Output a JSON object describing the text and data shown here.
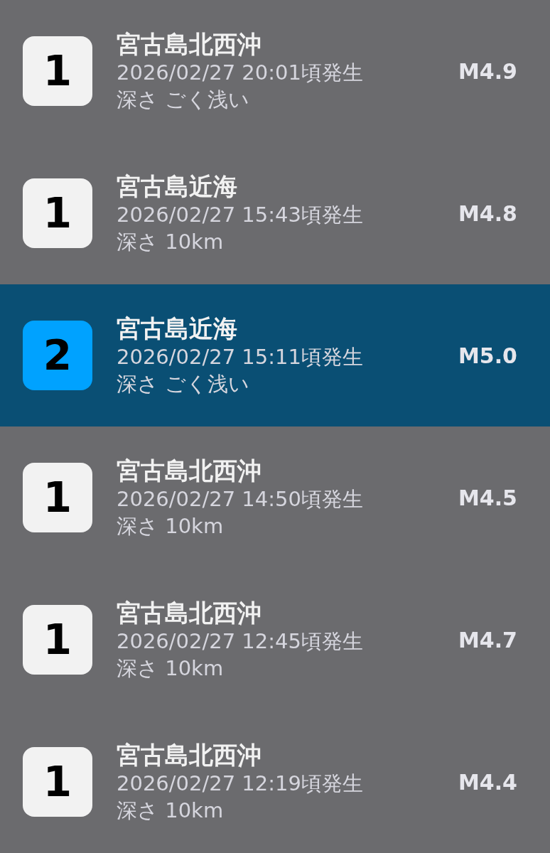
{
  "quakes": [
    {
      "intensity": "1",
      "color": "#f2f2f2",
      "place": "宮古島北西沖",
      "time": "2026/02/27 20:01頃発生",
      "depth": "深さ ごく浅い",
      "magnitude": "M4.9",
      "selected": false
    },
    {
      "intensity": "1",
      "color": "#f2f2f2",
      "place": "宮古島近海",
      "time": "2026/02/27 15:43頃発生",
      "depth": "深さ 10km",
      "magnitude": "M4.8",
      "selected": false
    },
    {
      "intensity": "2",
      "color": "#00a2ff",
      "place": "宮古島近海",
      "time": "2026/02/27 15:11頃発生",
      "depth": "深さ ごく浅い",
      "magnitude": "M5.0",
      "selected": true
    },
    {
      "intensity": "1",
      "color": "#f2f2f2",
      "place": "宮古島北西沖",
      "time": "2026/02/27 14:50頃発生",
      "depth": "深さ 10km",
      "magnitude": "M4.5",
      "selected": false
    },
    {
      "intensity": "1",
      "color": "#f2f2f2",
      "place": "宮古島北西沖",
      "time": "2026/02/27 12:45頃発生",
      "depth": "深さ 10km",
      "magnitude": "M4.7",
      "selected": false
    },
    {
      "intensity": "1",
      "color": "#f2f2f2",
      "place": "宮古島北西沖",
      "time": "2026/02/27 12:19頃発生",
      "depth": "深さ 10km",
      "magnitude": "M4.4",
      "selected": false
    }
  ]
}
